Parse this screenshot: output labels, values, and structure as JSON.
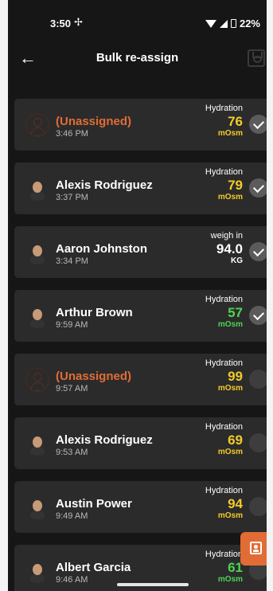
{
  "status": {
    "time": "3:50",
    "fan": "✢",
    "battery": "22%"
  },
  "toolbar": {
    "title": "Bulk re-assign"
  },
  "items": [
    {
      "name": "(Unassigned)",
      "time": "3:46 PM",
      "label": "Hydration",
      "value": "76",
      "unit": "mOsm",
      "color": "yellow",
      "checked": true,
      "unassigned": true
    },
    {
      "name": "Alexis Rodriguez",
      "time": "3:37 PM",
      "label": "Hydration",
      "value": "79",
      "unit": "mOsm",
      "color": "yellow",
      "checked": true,
      "unassigned": false
    },
    {
      "name": "Aaron Johnston",
      "time": "3:34 PM",
      "label": "weigh in",
      "value": "94.0",
      "unit": "KG",
      "color": "white",
      "checked": true,
      "unassigned": false
    },
    {
      "name": "Arthur Brown",
      "time": "9:59 AM",
      "label": "Hydration",
      "value": "57",
      "unit": "mOsm",
      "color": "green",
      "checked": true,
      "unassigned": false
    },
    {
      "name": "(Unassigned)",
      "time": "9:57 AM",
      "label": "Hydration",
      "value": "99",
      "unit": "mOsm",
      "color": "yellow",
      "checked": false,
      "unassigned": true
    },
    {
      "name": "Alexis Rodriguez",
      "time": "9:53 AM",
      "label": "Hydration",
      "value": "69",
      "unit": "mOsm",
      "color": "yellow",
      "checked": false,
      "unassigned": false
    },
    {
      "name": "Austin Power",
      "time": "9:49 AM",
      "label": "Hydration",
      "value": "94",
      "unit": "mOsm",
      "color": "yellow",
      "checked": false,
      "unassigned": false
    },
    {
      "name": "Albert Garcia",
      "time": "9:46 AM",
      "label": "Hydration",
      "value": "61",
      "unit": "mOsm",
      "color": "green",
      "checked": false,
      "unassigned": false
    }
  ]
}
